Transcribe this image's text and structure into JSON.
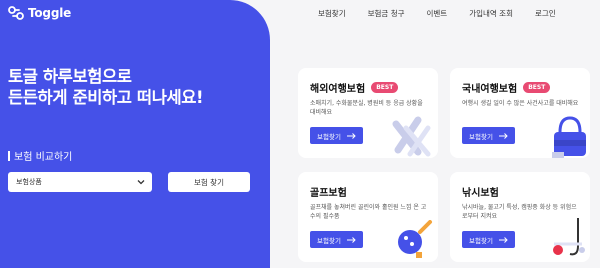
{
  "brand": {
    "name": "Toggle"
  },
  "nav": [
    "보험찾기",
    "보험금 청구",
    "이벤트",
    "가입내역 조회",
    "로그인"
  ],
  "hero": {
    "title_line1": "토글 하루보험으로",
    "title_line2": "든든하게 준비하고 떠나세요!",
    "compare_label": "보험 비교하기",
    "select_value": "보험상품",
    "find_button": "보험 찾기"
  },
  "cards": [
    {
      "title": "해외여행보험",
      "badge": "BEST",
      "desc": "소매치기, 수화물분실, 병원비 등 응급 상황을 대비해요",
      "button": "보험찾기"
    },
    {
      "title": "국내여행보험",
      "badge": "BEST",
      "desc": "여행시 생길 일이 수 많은 사건사고를 대비해요",
      "button": "보험찾기"
    },
    {
      "title": "골프보험",
      "badge": "",
      "desc": "골프채를 놓쳐버린 골린이와 홀인원 느낌 온 고수의 필수품",
      "button": "보험찾기"
    },
    {
      "title": "낚시보험",
      "badge": "",
      "desc": "낚시바늘, 물고기 특성, 캠핑중 화상 등 위험으로부터 지켜요",
      "button": "보험찾기"
    }
  ],
  "colors": {
    "primary": "#4551e8",
    "badge": "#e84a72",
    "background": "#f5f5f7"
  }
}
